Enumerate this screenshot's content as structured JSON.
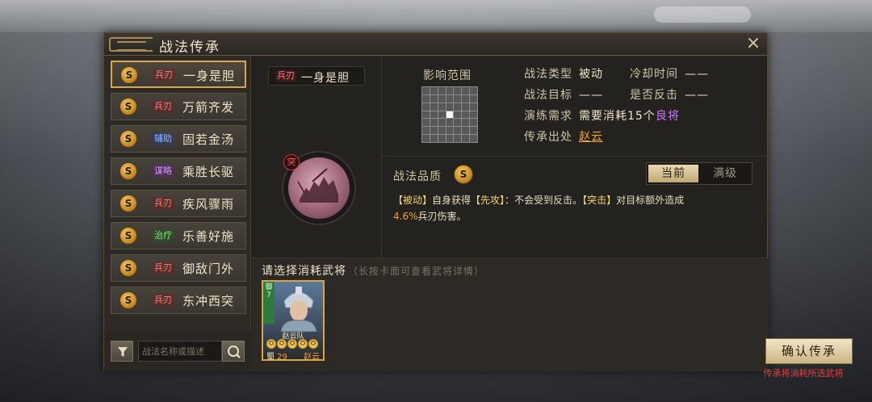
{
  "window": {
    "title": "战法传承"
  },
  "close_icon": "×",
  "skills": [
    {
      "badge": "S",
      "tag": "兵刃",
      "tag_type": "blade",
      "name": "一身是胆",
      "active": true
    },
    {
      "badge": "S",
      "tag": "兵刃",
      "tag_type": "blade",
      "name": "万箭齐发",
      "active": false
    },
    {
      "badge": "S",
      "tag": "辅助",
      "tag_type": "assist",
      "name": "固若金汤",
      "active": false
    },
    {
      "badge": "S",
      "tag": "谋略",
      "tag_type": "strat",
      "name": "乘胜长驱",
      "active": false
    },
    {
      "badge": "S",
      "tag": "兵刃",
      "tag_type": "blade",
      "name": "疾风骤雨",
      "active": false
    },
    {
      "badge": "S",
      "tag": "治疗",
      "tag_type": "heal",
      "name": "乐善好施",
      "active": false
    },
    {
      "badge": "S",
      "tag": "兵刃",
      "tag_type": "blade",
      "name": "御敌门外",
      "active": false
    },
    {
      "badge": "S",
      "tag": "兵刃",
      "tag_type": "blade",
      "name": "东冲西突",
      "active": false
    }
  ],
  "search": {
    "placeholder": "战法名称或描述"
  },
  "selected": {
    "tag": "兵刃",
    "name": "一身是胆",
    "icon_badge": "突"
  },
  "range": {
    "title": "影响范围"
  },
  "info": {
    "type_label": "战法类型",
    "type_value": "被动",
    "cooldown_label": "冷却时间",
    "cooldown_value": "——",
    "target_label": "战法目标",
    "target_value": "——",
    "counter_label": "是否反击",
    "counter_value": "——",
    "req_label": "演练需求",
    "req_prefix": "需要消耗",
    "req_num": "15个",
    "req_good": "良将",
    "source_label": "传承出处",
    "source_value": "赵云"
  },
  "quality": {
    "label": "战法品质",
    "badge": "S",
    "tab_current": "当前",
    "tab_max": "满级"
  },
  "description": {
    "p1": "【被动】",
    "p2": "自身获得",
    "p3": "【先攻】",
    "p4": "：不会受到反击。",
    "p5": "【突击】",
    "p6": "对目标额外造成",
    "p7": "4.6%",
    "p8": "兵刃伤害。"
  },
  "select": {
    "title": "请选择消耗武将",
    "hint": "（长按卡面可查看武将详情）"
  },
  "card": {
    "side_tag": "御7",
    "unit_name": "赵云队",
    "faction": "蜀",
    "level": "29",
    "general_name": "赵云",
    "stars": [
      "✪",
      "✪",
      "✪",
      "✪",
      "✪"
    ]
  },
  "confirm": {
    "label": "确认传承",
    "hint": "传承将消耗所选武将"
  },
  "colors": {
    "accent": "#d9a54a",
    "blade_tag": "#ff7d7d",
    "warning": "#e04040"
  }
}
